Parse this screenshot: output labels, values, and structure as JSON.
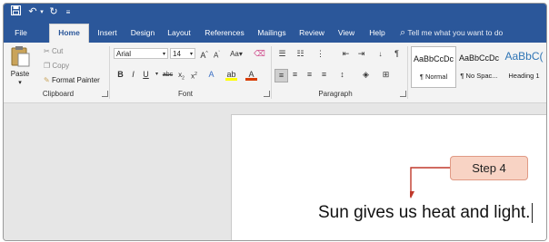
{
  "qat": {
    "save_icon": "save-icon",
    "undo_icon": "undo-icon",
    "redo_icon": "redo-icon",
    "customize_icon": "customize-icon"
  },
  "tabs": [
    {
      "label": "File"
    },
    {
      "label": "Home"
    },
    {
      "label": "Insert"
    },
    {
      "label": "Design"
    },
    {
      "label": "Layout"
    },
    {
      "label": "References"
    },
    {
      "label": "Mailings"
    },
    {
      "label": "Review"
    },
    {
      "label": "View"
    },
    {
      "label": "Help"
    }
  ],
  "tell_me": "Tell me what you want to do",
  "clipboard": {
    "paste": "Paste",
    "cut": "Cut",
    "copy": "Copy",
    "format_painter": "Format Painter",
    "label": "Clipboard"
  },
  "font": {
    "name": "Arial",
    "size": "14",
    "label": "Font"
  },
  "paragraph": {
    "label": "Paragraph"
  },
  "styles": [
    {
      "preview": "AaBbCcDc",
      "name": "¶ Normal"
    },
    {
      "preview": "AaBbCcDc",
      "name": "¶ No Spac..."
    },
    {
      "preview": "AaBbC(",
      "name": "Heading 1"
    }
  ],
  "document": {
    "text": "Sun gives us heat and light."
  },
  "annotation": {
    "label": "Step 4",
    "color": "#c0392b"
  },
  "colors": {
    "ribbon_blue": "#2b579a",
    "callout_bg": "#f8d3c4",
    "arrow": "#c0392b"
  }
}
